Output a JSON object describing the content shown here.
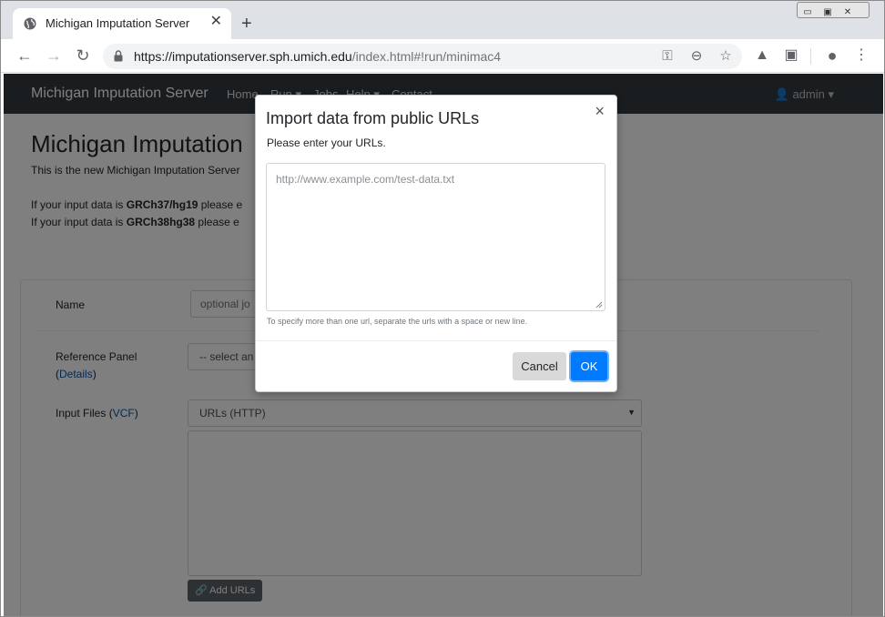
{
  "browser": {
    "tab_title": "Michigan Imputation Server",
    "tab_close": "✕",
    "new_tab": "+",
    "url_host": "https://imputationserver.sph.umich.edu",
    "url_path": "/index.html#!run/minimac4",
    "icons": [
      "back-icon",
      "forward-icon",
      "reload-icon",
      "lock-icon",
      "key-icon",
      "zoom-icon",
      "star-icon",
      "drive-icon",
      "extension-icon",
      "profile-icon",
      "menu-icon"
    ]
  },
  "navbar": {
    "brand": "Michigan Imputation Server",
    "links": [
      "Home",
      "Run ▾",
      "Jobs",
      "Help ▾",
      "Contact"
    ],
    "admin": "admin ▾"
  },
  "page": {
    "title": "Michigan Imputation",
    "intro": "This is the new Michigan Imputation Server",
    "line1_prefix": "If your input data is ",
    "line1_build": "GRCh37/hg19",
    "line1_suffix": " please e",
    "line2_prefix": "If your input data is ",
    "line2_build": "GRCh38hg38",
    "line2_suffix": " please e"
  },
  "form": {
    "name_label": "Name",
    "name_placeholder": "optional jo",
    "reference_label": "Reference Panel",
    "reference_details_open": "(",
    "reference_details_link": "Details",
    "reference_details_close": ")",
    "reference_select": "-- select an",
    "input_label_prefix": "Input Files (",
    "input_label_link": "VCF",
    "input_label_suffix": ")",
    "input_select": "URLs (HTTP)",
    "add_urls": "Add URLs"
  },
  "modal": {
    "title": "Import data from public URLs",
    "close": "×",
    "subtitle": "Please enter your URLs.",
    "placeholder": "http://www.example.com/test-data.txt",
    "help": "To specify more than one url, separate the urls with a space or new line.",
    "cancel": "Cancel",
    "ok": "OK"
  },
  "colors": {
    "navbar": "#343a40",
    "primary": "#007bff",
    "secondary": "#5a6268"
  }
}
